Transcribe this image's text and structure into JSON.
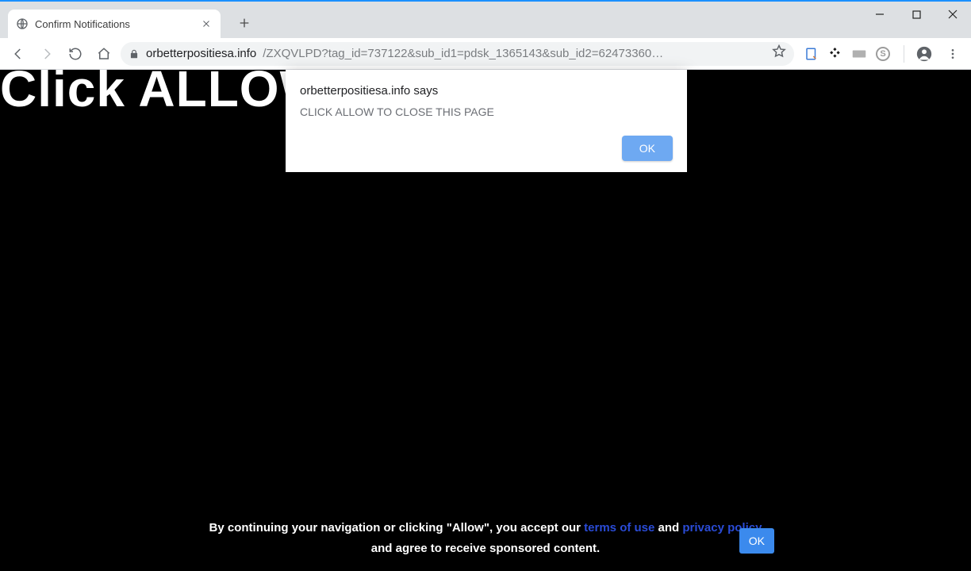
{
  "tab": {
    "title": "Confirm Notifications"
  },
  "url": {
    "domain": "orbetterpositiesa.info",
    "rest": "/ZXQVLPD?tag_id=737122&sub_id1=pdsk_1365143&sub_id2=62473360…"
  },
  "page": {
    "headline": "Click ALLOW                         you are not",
    "footer_prefix": "By continuing your navigation or clicking \"Allow\", you accept our ",
    "footer_terms": "terms of use",
    "footer_and": " and ",
    "footer_privacy": "privacy policy",
    "footer_line2": "and agree to receive sponsored content.",
    "footer_ok": "OK"
  },
  "dialog": {
    "title": "orbetterpositiesa.info says",
    "body": "CLICK ALLOW TO CLOSE THIS PAGE",
    "ok": "OK"
  }
}
